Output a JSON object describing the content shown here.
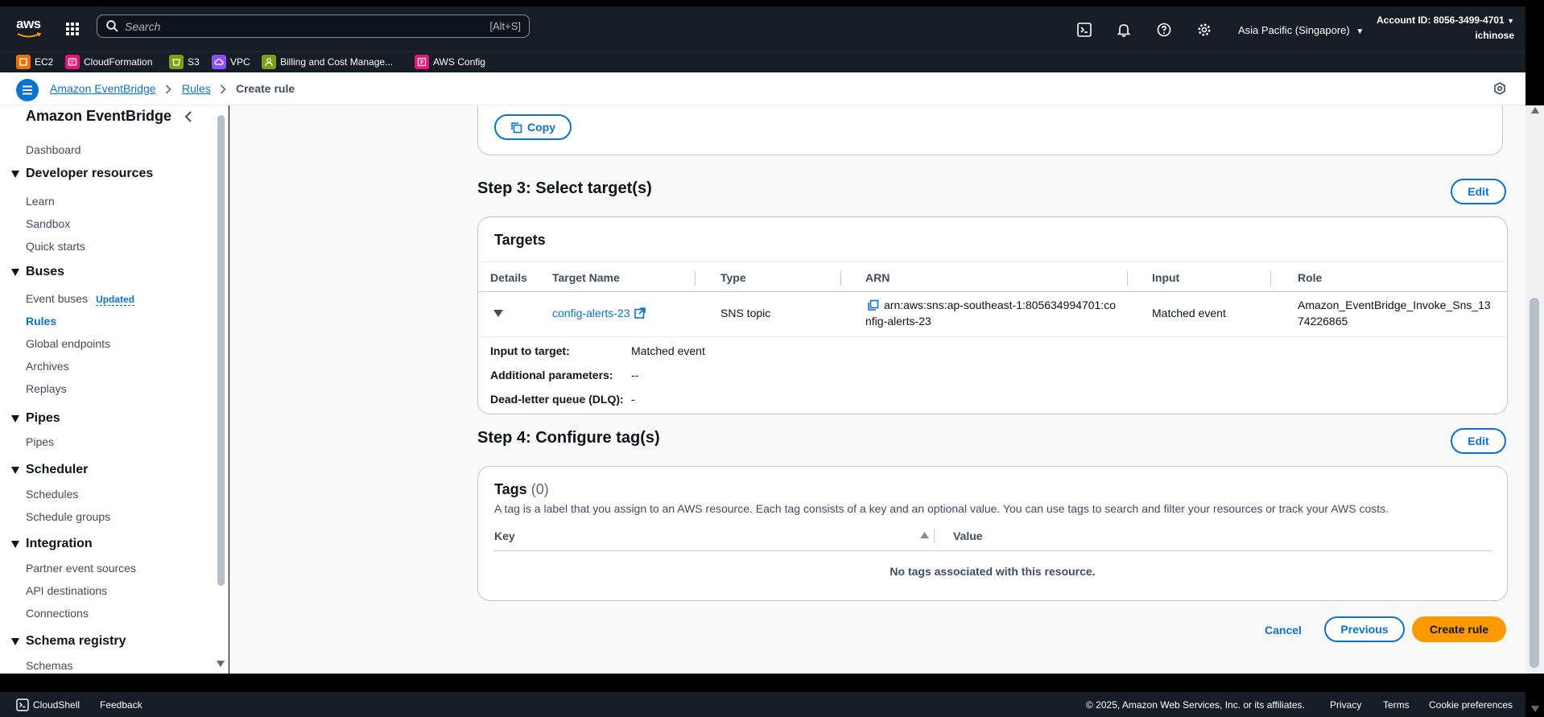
{
  "topnav": {
    "logo_text": "aws",
    "search_placeholder": "Search",
    "search_shortcut": "[Alt+S]",
    "region": "Asia Pacific (Singapore)",
    "account_id": "Account ID: 8056-3499-4701",
    "user": "ichinose"
  },
  "favorites": [
    {
      "label": "EC2",
      "color": "#ed7100"
    },
    {
      "label": "CloudFormation",
      "color": "#e7157b"
    },
    {
      "label": "S3",
      "color": "#7aa116"
    },
    {
      "label": "VPC",
      "color": "#8c4fff"
    },
    {
      "label": "Billing and Cost Manage...",
      "color": "#7aa116"
    },
    {
      "label": "AWS Config",
      "color": "#e7157b"
    }
  ],
  "breadcrumb": {
    "service": "Amazon EventBridge",
    "section": "Rules",
    "current": "Create rule"
  },
  "sidebar": {
    "title": "Amazon EventBridge",
    "dashboard": "Dashboard",
    "sections": {
      "developer": {
        "title": "Developer resources",
        "items": [
          "Learn",
          "Sandbox",
          "Quick starts"
        ]
      },
      "buses": {
        "title": "Buses",
        "items": [
          "Event buses",
          "Rules",
          "Global endpoints",
          "Archives",
          "Replays"
        ],
        "badge": "Updated"
      },
      "pipes": {
        "title": "Pipes",
        "items": [
          "Pipes"
        ]
      },
      "scheduler": {
        "title": "Scheduler",
        "items": [
          "Schedules",
          "Schedule groups"
        ]
      },
      "integration": {
        "title": "Integration",
        "items": [
          "Partner event sources",
          "API destinations",
          "Connections"
        ]
      },
      "schema": {
        "title": "Schema registry",
        "items": [
          "Schemas"
        ]
      }
    }
  },
  "main": {
    "copy_label": "Copy",
    "step3": {
      "title": "Step 3: Select target(s)",
      "edit": "Edit",
      "card_title": "Targets",
      "columns": [
        "Details",
        "Target Name",
        "Type",
        "ARN",
        "Input",
        "Role"
      ],
      "row": {
        "target_name": "config-alerts-23",
        "type": "SNS topic",
        "arn_line1": "arn:aws:sns:ap-southeast-1:805634994701:co",
        "arn_line2": "nfig-alerts-23",
        "input": "Matched event",
        "role_line1": "Amazon_EventBridge_Invoke_Sns_13",
        "role_line2": "74226865"
      },
      "details": [
        {
          "key": "Input to target:",
          "value": "Matched event"
        },
        {
          "key": "Additional parameters:",
          "value": "--"
        },
        {
          "key": "Dead-letter queue (DLQ):",
          "value": "-"
        }
      ]
    },
    "step4": {
      "title": "Step 4: Configure tag(s)",
      "edit": "Edit",
      "card_title": "Tags",
      "count": "(0)",
      "description": "A tag is a label that you assign to an AWS resource. Each tag consists of a key and an optional value. You can use tags to search and filter your resources or track your AWS costs.",
      "col_key": "Key",
      "col_value": "Value",
      "empty": "No tags associated with this resource."
    },
    "actions": {
      "cancel": "Cancel",
      "previous": "Previous",
      "create": "Create rule"
    }
  },
  "footer": {
    "cloudshell": "CloudShell",
    "feedback": "Feedback",
    "copyright": "© 2025, Amazon Web Services, Inc. or its affiliates.",
    "privacy": "Privacy",
    "terms": "Terms",
    "cookies": "Cookie preferences"
  },
  "colors": {
    "nav_bg": "#161d26",
    "link": "#0972d3",
    "primary_button": "#ff9900"
  }
}
